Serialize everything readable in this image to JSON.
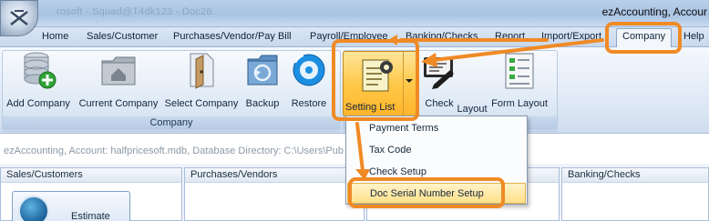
{
  "window": {
    "title_faded": "rosoft - Squad@T4dk123 - Doc26",
    "title": "ezAccounting, Accour"
  },
  "menu": {
    "items": [
      "Home",
      "Sales/Customer",
      "Purchases/Vendor/Pay Bill",
      "Payroll/Employee",
      "Banking/Checks",
      "Report",
      "Import/Export",
      "Company",
      "Help"
    ]
  },
  "ribbon": {
    "company_group_label": "Company",
    "buttons": {
      "add_company": "Add Company",
      "current_company": "Current Company",
      "select_company": "Select Company",
      "backup": "Backup",
      "restore": "Restore",
      "setting_list": "Setting List",
      "check": "Check",
      "layout": "Layout",
      "form_layout": "Form Layout"
    }
  },
  "infobar": {
    "text": "ezAccounting, Account: halfpricesoft.mdb, Database Directory: C:\\Users\\Pub"
  },
  "panels": {
    "sales": "Sales/Customers",
    "purchases": "Purchases/Vendors",
    "banking": "Banking/Checks",
    "estimate_tile": "Estimate"
  },
  "dropdown": {
    "items": [
      "Payment Terms",
      "Tax Code",
      "Check Setup",
      "Doc Serial Number Setup"
    ]
  },
  "colors": {
    "annotation": "#f08a24",
    "ribbon_bg": "#dde8f5",
    "hover": "#ffe08a"
  }
}
